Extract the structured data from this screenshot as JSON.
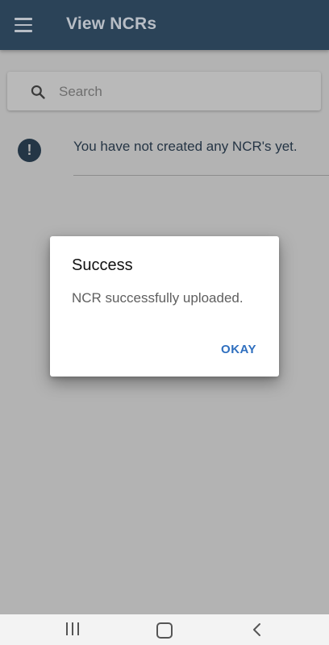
{
  "app_bar": {
    "title": "View NCRs",
    "menu_icon": "hamburger-menu-icon"
  },
  "search": {
    "placeholder": "Search",
    "value": "",
    "icon": "search-icon"
  },
  "empty_state": {
    "icon": "exclamation-circle-icon",
    "message": "You have not created any NCR's yet."
  },
  "dialog": {
    "title": "Success",
    "message": "NCR successfully uploaded.",
    "okay_label": "OKAY",
    "accent_color": "#2f6fbf"
  },
  "nav_bar": {
    "recents_icon": "recents-icon",
    "home_icon": "home-icon",
    "back_icon": "back-icon"
  },
  "colors": {
    "app_bar": "#2b4358",
    "scrim": "#b3b3b3"
  }
}
